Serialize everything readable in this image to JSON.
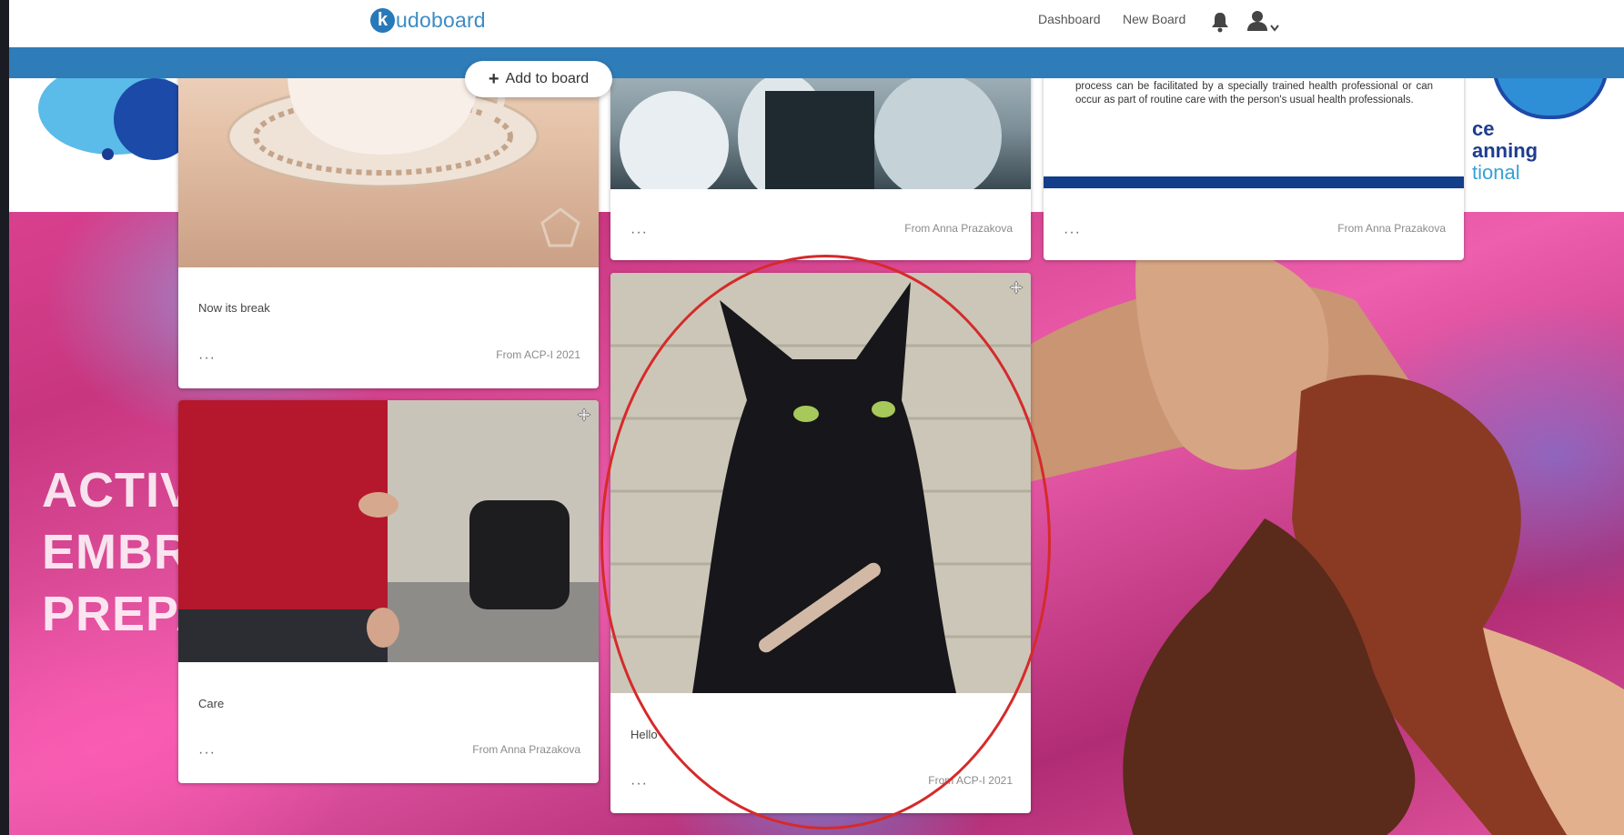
{
  "nav": {
    "brand_letter": "k",
    "brand_rest": "udoboard",
    "links": [
      "Dashboard",
      "New Board"
    ],
    "bell_icon": "bell-icon",
    "user_icon": "user-menu-icon"
  },
  "add_to_board": {
    "label": "Add to board"
  },
  "header_art": {
    "right_text_line1": "ce",
    "right_text_line2": "anning",
    "right_text_line3": "tional",
    "big_lines": [
      "ACTIV",
      "EMBR",
      "PREPA"
    ]
  },
  "cards": {
    "c1": {
      "message": "Now its break",
      "menu": "···",
      "from": "From ACP-I 2021"
    },
    "c2": {
      "message": "Care",
      "menu": "···",
      "from": "From Anna Prazakova"
    },
    "c3": {
      "menu": "···",
      "from": "From Anna Prazakova"
    },
    "c4": {
      "message": "Hello",
      "menu": "···",
      "from": "From ACP-I 2021"
    },
    "c5": {
      "text": "process can be facilitated by a specially trained health professional or can occur as part of routine care with the person's usual health professionals.",
      "menu": "···",
      "from": "From Anna Prazakova"
    }
  },
  "colors": {
    "accent": "#2e7cb8",
    "highlight": "#d62a2a"
  }
}
